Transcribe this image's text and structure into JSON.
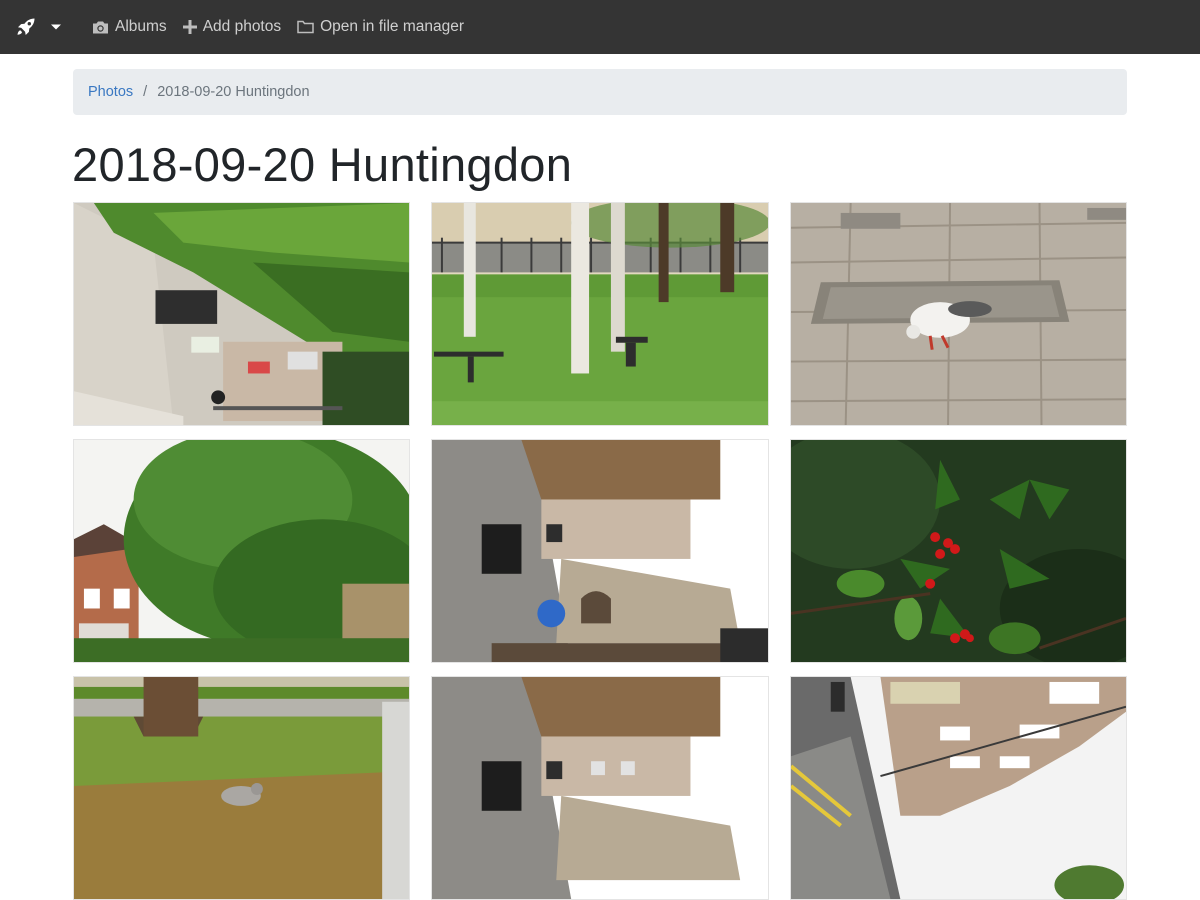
{
  "navbar": {
    "brand_icon": "rocket-icon",
    "dropdown_icon": "caret-down-icon",
    "items": [
      {
        "label": "Albums",
        "icon": "camera-icon"
      },
      {
        "label": "Add photos",
        "icon": "plus-icon"
      },
      {
        "label": "Open in file manager",
        "icon": "folder-icon"
      }
    ],
    "background": "#343434"
  },
  "breadcrumb": {
    "root": "Photos",
    "separator": "/",
    "current": "2018-09-20 Huntingdon"
  },
  "page": {
    "title": "2018-09-20 Huntingdon"
  },
  "colors": {
    "link": "#3a78c2",
    "breadcrumb_bg": "#e9ecef"
  }
}
